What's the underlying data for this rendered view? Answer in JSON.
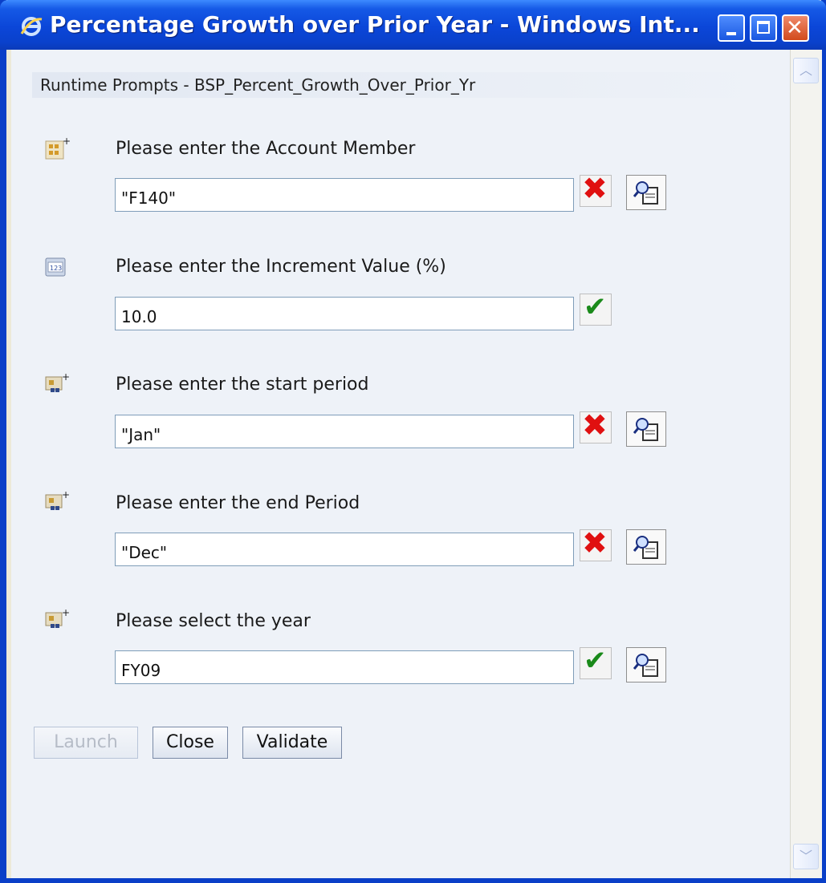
{
  "window": {
    "title": "Percentage Growth over Prior Year - Windows Int...",
    "controls": {
      "minimize": "minimize",
      "maximize": "maximize",
      "close": "close"
    }
  },
  "header": {
    "title": "Runtime Prompts - BSP_Percent_Growth_Over_Prior_Yr"
  },
  "prompts": [
    {
      "label": "Please enter the Account Member",
      "value": "\"F140\"",
      "icon": "member-prompt-icon",
      "status": "invalid",
      "has_lookup": true
    },
    {
      "label": "Please enter the Increment Value (%)",
      "value": "10.0",
      "icon": "numeric-prompt-icon",
      "status": "valid",
      "has_lookup": false
    },
    {
      "label": "Please enter the start period",
      "value": "\"Jan\"",
      "icon": "dimension-prompt-icon",
      "status": "invalid",
      "has_lookup": true
    },
    {
      "label": "Please enter the end Period",
      "value": "\"Dec\"",
      "icon": "dimension-prompt-icon",
      "status": "invalid",
      "has_lookup": true
    },
    {
      "label": "Please select the year",
      "value": "FY09",
      "icon": "dimension-prompt-icon",
      "status": "valid",
      "has_lookup": true
    }
  ],
  "actions": {
    "launch": "Launch",
    "close": "Close",
    "validate": "Validate"
  },
  "colors": {
    "titlebar": "#0b46d8",
    "invalid": "#e01010",
    "valid": "#1a8a1a"
  }
}
